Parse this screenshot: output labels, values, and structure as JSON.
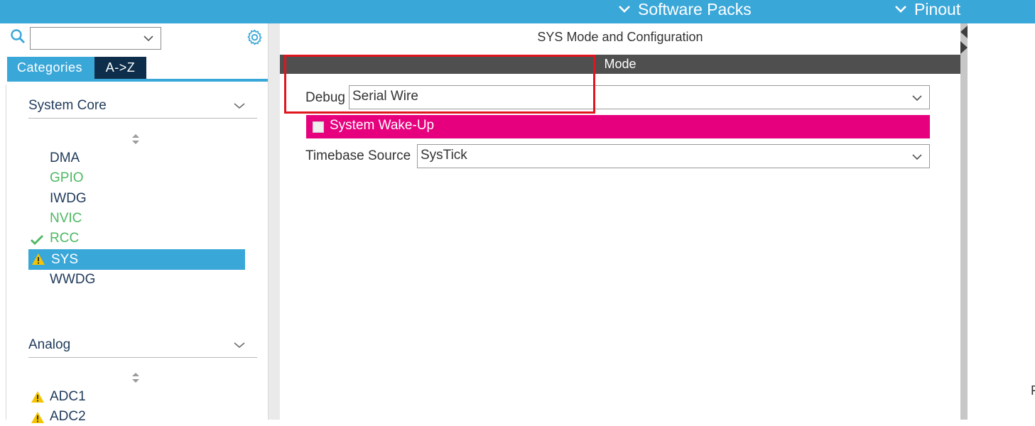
{
  "topbar": {
    "menus": [
      {
        "label": "Software Packs"
      },
      {
        "label": "Pinout"
      }
    ]
  },
  "sidebar": {
    "search": {
      "value": ""
    },
    "tabs": [
      {
        "label": "Categories",
        "active": true
      },
      {
        "label": "A->Z",
        "active": false
      }
    ],
    "sections": [
      {
        "label": "System Core",
        "items": [
          {
            "label": "DMA",
            "status": "none"
          },
          {
            "label": "GPIO",
            "status": "configured"
          },
          {
            "label": "IWDG",
            "status": "none"
          },
          {
            "label": "NVIC",
            "status": "configured"
          },
          {
            "label": "RCC",
            "status": "ok"
          },
          {
            "label": "SYS",
            "status": "warning",
            "selected": true
          },
          {
            "label": "WWDG",
            "status": "none"
          }
        ]
      },
      {
        "label": "Analog",
        "items": [
          {
            "label": "ADC1",
            "status": "warning"
          },
          {
            "label": "ADC2",
            "status": "warning"
          }
        ]
      }
    ]
  },
  "main": {
    "title": "SYS Mode and Configuration",
    "mode_header": "Mode",
    "debug": {
      "label": "Debug",
      "value": "Serial Wire"
    },
    "wakeup": {
      "label": "System Wake-Up",
      "checked": false
    },
    "timebase": {
      "label": "Timebase Source",
      "value": "SysTick"
    }
  },
  "stray_text": "F",
  "colors": {
    "accent": "#3aa7d9",
    "tab_dark": "#0d2d4a",
    "configured_green": "#4db862",
    "wakeup_magenta": "#e6007e",
    "mode_bar": "#4f4f4f",
    "highlight_red": "#e0161f",
    "warning_yellow": "#f5c400"
  }
}
